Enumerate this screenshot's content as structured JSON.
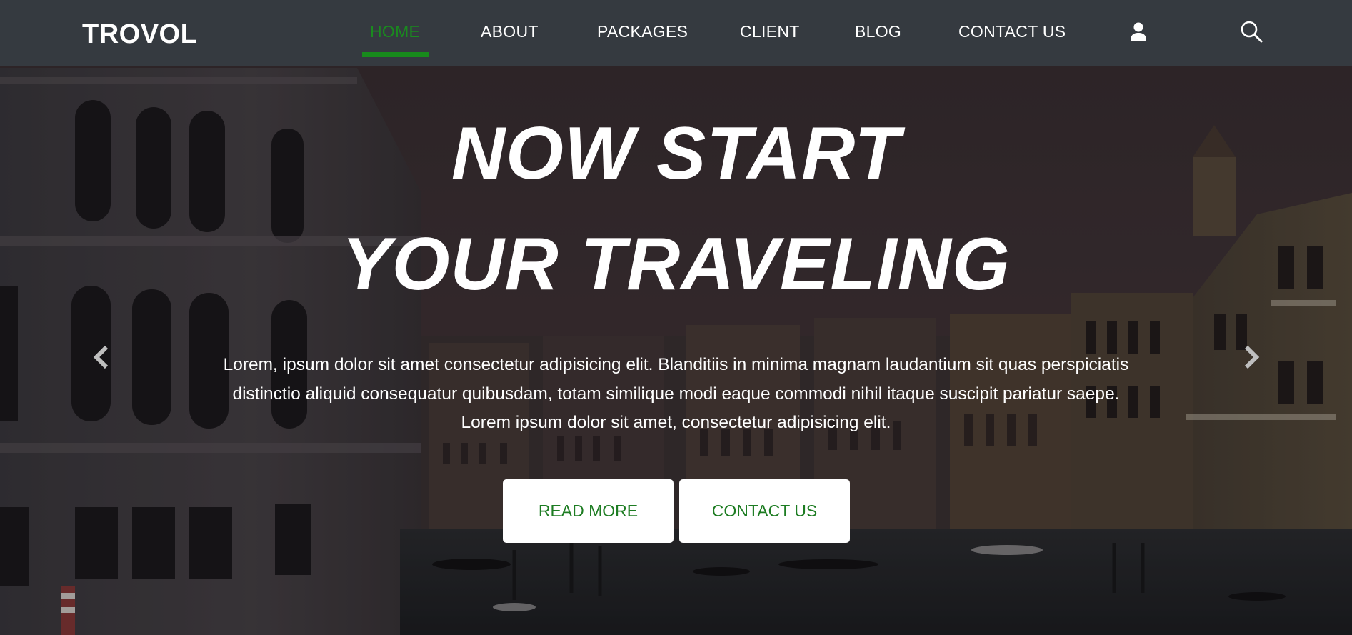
{
  "navbar": {
    "brand": "TROVOL",
    "items": [
      {
        "label": "HOME",
        "active": true
      },
      {
        "label": "ABOUT",
        "active": false
      },
      {
        "label": "PACKAGES",
        "active": false
      },
      {
        "label": "CLIENT",
        "active": false
      },
      {
        "label": "BLOG",
        "active": false
      },
      {
        "label": "CONTACT US",
        "active": false
      }
    ],
    "icons": [
      "user-icon",
      "search-icon"
    ]
  },
  "hero": {
    "title_line1": "NOW START",
    "title_line2": "YOUR TRAVELING",
    "text": "Lorem, ipsum dolor sit amet consectetur adipisicing elit. Blanditiis in minima magnam laudantium sit quas perspiciatis distinctio aliquid consequatur quibusdam, totam similique modi eaque commodi nihil itaque suscipit pariatur saepe. Lorem ipsum dolor sit amet, consectetur adipisicing elit.",
    "buttons": {
      "read_more": "READ MORE",
      "contact_us": "CONTACT US"
    },
    "carousel_controls": [
      "chevron-left-icon",
      "chevron-right-icon"
    ]
  },
  "colors": {
    "navbar_bg": "#353a40",
    "accent_green": "#188a1c",
    "button_text_green": "#1d7c22",
    "button_bg": "#ffffff"
  }
}
